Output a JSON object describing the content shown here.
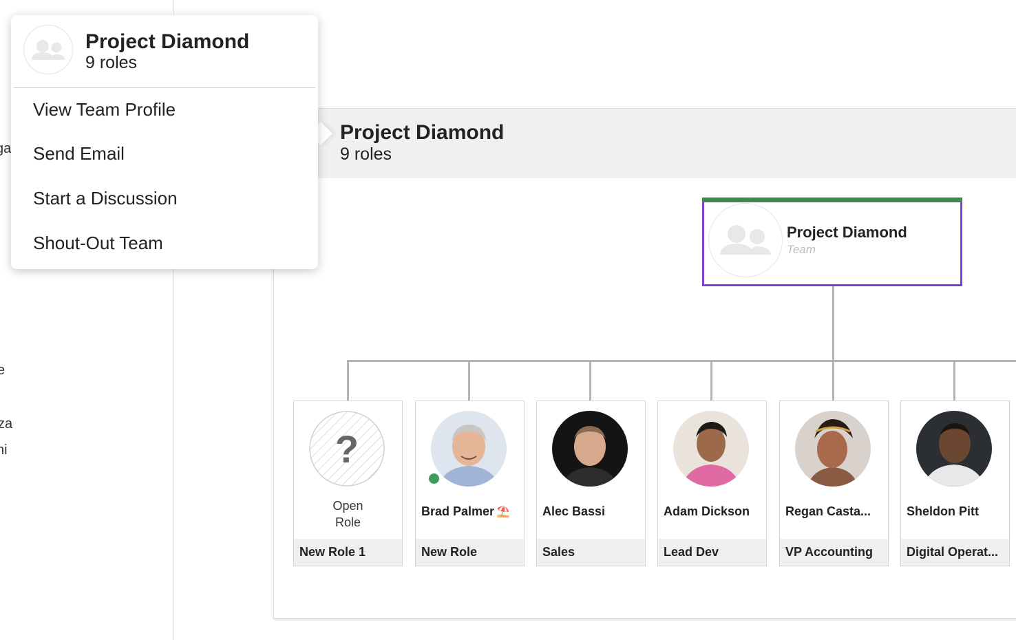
{
  "sidebar": {
    "fragments": [
      "gal",
      "e",
      "za",
      "ni"
    ]
  },
  "team_panel": {
    "title": "Project Diamond",
    "subtitle": "9 roles"
  },
  "root_card": {
    "name": "Project Diamond",
    "type": "Team",
    "accent_color": "#3d8a4e",
    "selected_border_color": "#7a3fd6"
  },
  "roles": [
    {
      "open_label": "Open\nRole",
      "person": "",
      "role": "New Role 1",
      "avatar": "question-mark-icon"
    },
    {
      "person": "Brad Palmer",
      "status_emoji": "⛱️",
      "role": "New Role",
      "avatar": "brad-palmer-avatar",
      "online": true
    },
    {
      "person": "Alec Bassi",
      "role": "Sales",
      "avatar": "alec-bassi-avatar"
    },
    {
      "person": "Adam Dickson",
      "role": "Lead Dev",
      "avatar": "adam-dickson-avatar"
    },
    {
      "person": "Regan Casta...",
      "role": "VP Accounting",
      "avatar": "regan-castaneda-avatar"
    },
    {
      "person": "Sheldon Pitt",
      "role": "Digital Operat...",
      "avatar": "sheldon-pitt-avatar"
    }
  ],
  "popup": {
    "title": "Project Diamond",
    "subtitle": "9 roles",
    "items": [
      "View Team Profile",
      "Send Email",
      "Start a Discussion",
      "Shout-Out Team"
    ]
  }
}
